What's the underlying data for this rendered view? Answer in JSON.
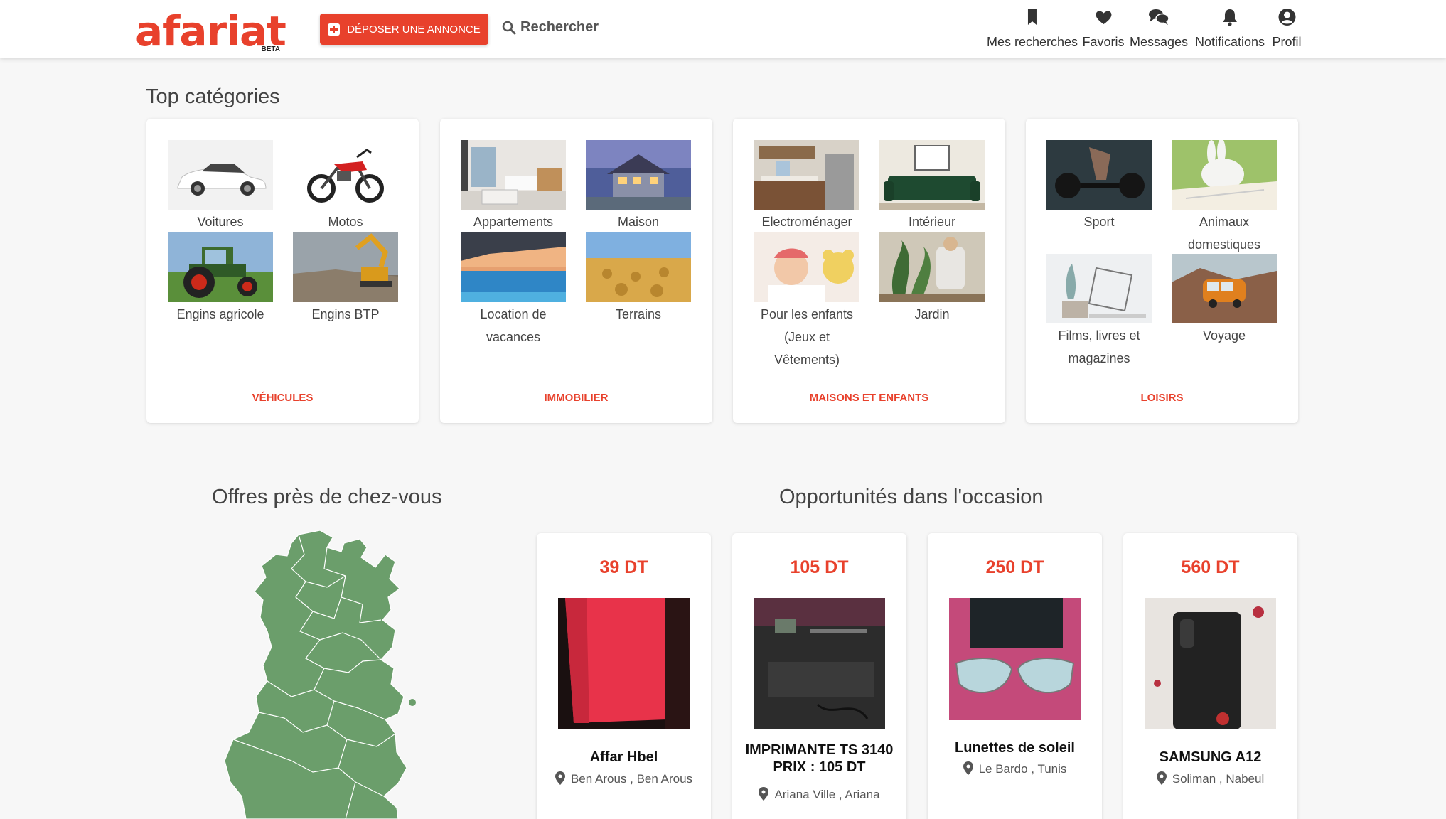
{
  "header": {
    "logo": "afariat",
    "logo_badge": "BETA",
    "post_button": "DÉPOSER UNE ANNONCE",
    "search": "Rechercher",
    "nav": [
      {
        "label": "Mes recherches",
        "icon": "bookmark-icon"
      },
      {
        "label": "Favoris",
        "icon": "heart-icon"
      },
      {
        "label": "Messages",
        "icon": "chat-icon"
      },
      {
        "label": "Notifications",
        "icon": "bell-icon"
      },
      {
        "label": "Profil",
        "icon": "user-circle-icon"
      }
    ]
  },
  "top_categories": {
    "title": "Top catégories",
    "cards": [
      {
        "footer": "VÉHICULES",
        "items": [
          {
            "label": "Voitures",
            "icon": "car-image"
          },
          {
            "label": "Motos",
            "icon": "motorbike-image"
          },
          {
            "label": "Engins agricole",
            "icon": "tractor-image"
          },
          {
            "label": "Engins BTP",
            "icon": "excavator-image"
          }
        ]
      },
      {
        "footer": "IMMOBILIER",
        "items": [
          {
            "label": "Appartements",
            "icon": "apartment-image"
          },
          {
            "label": "Maison",
            "icon": "house-image"
          },
          {
            "label": "Location de vacances",
            "icon": "pool-image"
          },
          {
            "label": "Terrains",
            "icon": "field-image"
          }
        ]
      },
      {
        "footer": "MAISONS ET ENFANTS",
        "items": [
          {
            "label": "Electroménager",
            "icon": "kitchen-image"
          },
          {
            "label": "Intérieur",
            "icon": "sofa-image"
          },
          {
            "label": "Pour les enfants (Jeux et Vêtements)",
            "icon": "baby-image"
          },
          {
            "label": "Jardin",
            "icon": "plants-image"
          }
        ]
      },
      {
        "footer": "LOISIRS",
        "items": [
          {
            "label": "Sport",
            "icon": "dumbbell-image"
          },
          {
            "label": "Animaux domestiques",
            "icon": "rabbit-image"
          },
          {
            "label": "Films, livres et magazines",
            "icon": "books-image"
          },
          {
            "label": "Voyage",
            "icon": "van-image"
          }
        ]
      }
    ]
  },
  "nearby": {
    "title": "Offres près de chez-vous",
    "map_color": "#6b9e6b"
  },
  "opportunities": {
    "title": "Opportunités dans l'occasion",
    "products": [
      {
        "price": "39 DT",
        "title": "Affar Hbel",
        "city": "Ben Arous",
        "region": "Ben Arous",
        "image": "red-bag-image"
      },
      {
        "price": "105 DT",
        "title": "IMPRIMANTE TS 3140 PRIX : 105 DT",
        "city": "Ariana Ville",
        "region": "Ariana",
        "image": "printer-image"
      },
      {
        "price": "250 DT",
        "title": "Lunettes de soleil",
        "city": "Le Bardo",
        "region": "Tunis",
        "image": "sunglasses-image"
      },
      {
        "price": "560 DT",
        "title": "SAMSUNG A12",
        "city": "Soliman",
        "region": "Nabeul",
        "image": "phone-box-image"
      }
    ]
  },
  "colors": {
    "accent": "#e8412c",
    "background": "#f7f7f7"
  }
}
